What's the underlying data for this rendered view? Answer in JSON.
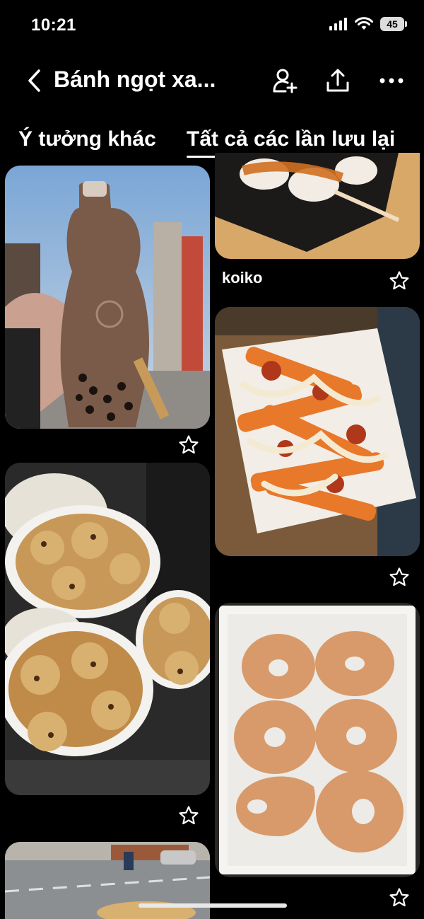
{
  "status_bar": {
    "time": "10:21",
    "battery": "45"
  },
  "header": {
    "title": "Bánh ngọt xa...",
    "icons": [
      "chevron-left-icon",
      "add-collaborator-icon",
      "share-icon",
      "more-icon"
    ]
  },
  "tabs": [
    {
      "label": "Ý tưởng khác",
      "active": false
    },
    {
      "label": "Tất cả các lần lưu lại",
      "active": true
    }
  ],
  "pins": {
    "bubble_tea": {
      "title": ""
    },
    "koiko": {
      "title": "koiko"
    },
    "loaded_fries": {
      "title": ""
    },
    "cookies": {
      "title": ""
    },
    "donuts": {
      "title": ""
    },
    "street": {
      "title": ""
    }
  },
  "colors": {
    "background": "#000000",
    "text": "#ffffff",
    "tab_indicator": "#ffffff"
  }
}
